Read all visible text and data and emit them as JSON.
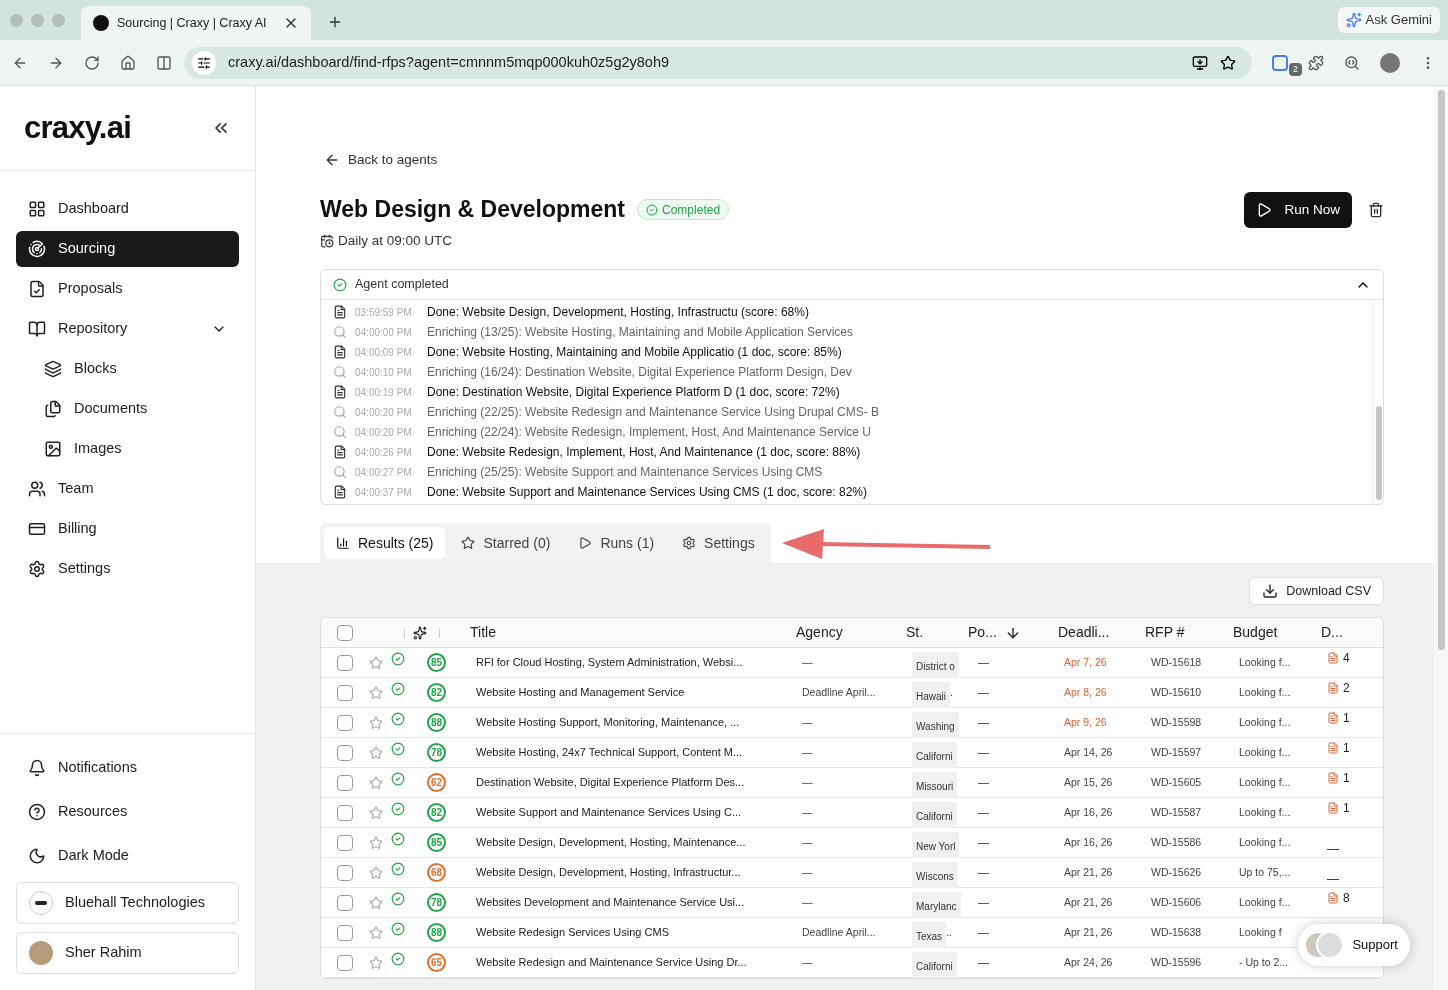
{
  "browser": {
    "tab_title": "Sourcing | Craxy | Craxy AI",
    "url": "craxy.ai/dashboard/find-rfps?agent=cmnnm5mqp000kuh0z5g2y8oh9",
    "gemini": "Ask Gemini",
    "tab_badge": "2"
  },
  "sidebar": {
    "logo": "craxy.ai",
    "items": [
      {
        "label": "Dashboard",
        "selected": false
      },
      {
        "label": "Sourcing",
        "selected": true
      },
      {
        "label": "Proposals",
        "selected": false
      },
      {
        "label": "Repository",
        "selected": false,
        "expanded": true,
        "children": [
          {
            "label": "Blocks",
            "selected": false
          },
          {
            "label": "Documents",
            "selected": false
          },
          {
            "label": "Images",
            "selected": false
          }
        ]
      },
      {
        "label": "Team",
        "selected": false
      },
      {
        "label": "Billing",
        "selected": false
      },
      {
        "label": "Settings",
        "selected": false
      }
    ],
    "bottom_items": [
      "Notifications",
      "Resources",
      "Dark Mode"
    ],
    "organization": "Bluehall Technologies",
    "user": "Sher Rahim"
  },
  "back_link": "Back to agents",
  "agent": {
    "title": "Web Design & Development",
    "status": "Completed",
    "schedule": "Daily at 09:00 UTC",
    "run_button": "Run Now"
  },
  "log": {
    "title": "Agent completed",
    "expanded": true,
    "entries": [
      {
        "kind": "done",
        "time": "03:59:59 PM",
        "text": "Done: Website Design, Development, Hosting, Infrastructu (score: 68%)"
      },
      {
        "kind": "enriching",
        "time": "04:00:00 PM",
        "text": "Enriching (13/25): Website Hosting, Maintaining and Mobile Application Services"
      },
      {
        "kind": "done",
        "time": "04:00:09 PM",
        "text": "Done: Website Hosting, Maintaining and Mobile Applicatio (1 doc, score: 85%)"
      },
      {
        "kind": "enriching",
        "time": "04:00:10 PM",
        "text": "Enriching (16/24): Destination Website, Digital Experience Platform Design, Dev"
      },
      {
        "kind": "done",
        "time": "04:00:19 PM",
        "text": "Done: Destination Website, Digital Experience Platform D (1 doc, score: 72%)"
      },
      {
        "kind": "enriching",
        "time": "04:00:20 PM",
        "text": "Enriching (22/25): Website Redesign and Maintenance Service Using Drupal CMS- B"
      },
      {
        "kind": "enriching",
        "time": "04:00:20 PM",
        "text": "Enriching (22/24): Website Redesign, Implement, Host, And Maintenance Service U"
      },
      {
        "kind": "done",
        "time": "04:00:26 PM",
        "text": "Done: Website Redesign, Implement, Host, And Maintenance (1 doc, score: 88%)"
      },
      {
        "kind": "enriching",
        "time": "04:00:27 PM",
        "text": "Enriching (25/25): Website Support and Maintenance Services Using CMS"
      },
      {
        "kind": "done",
        "time": "04:00:37 PM",
        "text": "Done: Website Support and Maintenance Services Using CMS (1 doc, score: 82%)"
      }
    ]
  },
  "tabs": [
    {
      "label": "Results (25)",
      "selected": true
    },
    {
      "label": "Starred (0)",
      "selected": false
    },
    {
      "label": "Runs (1)",
      "selected": false
    },
    {
      "label": "Settings",
      "selected": false
    }
  ],
  "download_button": "Download CSV",
  "table": {
    "all_checked": false,
    "columns": [
      "Title",
      "Agency",
      "St.",
      "Po...",
      "Deadli...",
      "RFP #",
      "Budget",
      "D..."
    ],
    "rows": [
      {
        "checked": false,
        "starred": false,
        "score": "85",
        "color": "#22a34a",
        "title": "RFI for Cloud Hosting, System Administration, Websi...",
        "agency": "—",
        "state": "District o",
        "po": "—",
        "deadline": "Apr 7, 26",
        "urgent": true,
        "rfp": "WD-15618",
        "budget": "Looking f...",
        "docs": "4"
      },
      {
        "checked": false,
        "starred": false,
        "score": "82",
        "color": "#22a34a",
        "title": "Website Hosting and Management Service",
        "agency": "Deadline April...",
        "state": "Hawaii",
        "state_more": ".",
        "po": "—",
        "deadline": "Apr 8, 26",
        "urgent": true,
        "rfp": "WD-15610",
        "budget": "Looking f...",
        "docs": "2"
      },
      {
        "checked": false,
        "starred": false,
        "score": "88",
        "color": "#22a34a",
        "title": "Website Hosting Support, Monitoring, Maintenance, ...",
        "agency": "—",
        "state": "Washing",
        "po": "—",
        "deadline": "Apr 9, 26",
        "urgent": true,
        "rfp": "WD-15598",
        "budget": "Looking f...",
        "docs": "1"
      },
      {
        "checked": false,
        "starred": false,
        "score": "78",
        "color": "#22a34a",
        "title": "Website Hosting, 24x7 Technical Support, Content M...",
        "agency": "—",
        "state": "Californi",
        "po": "—",
        "deadline": "Apr 14, 26",
        "urgent": false,
        "rfp": "WD-15597",
        "budget": "Looking f...",
        "docs": "1"
      },
      {
        "checked": false,
        "starred": false,
        "score": "62",
        "color": "#e0702f",
        "title": "Destination Website, Digital Experience Platform Des...",
        "agency": "—",
        "state": "Missouri",
        "po": "—",
        "deadline": "Apr 15, 26",
        "urgent": false,
        "rfp": "WD-15605",
        "budget": "Looking f...",
        "docs": "1"
      },
      {
        "checked": false,
        "starred": false,
        "score": "82",
        "color": "#22a34a",
        "title": "Website Support and Maintenance Services Using C...",
        "agency": "—",
        "state": "Californi",
        "po": "—",
        "deadline": "Apr 16, 26",
        "urgent": false,
        "rfp": "WD-15587",
        "budget": "Looking f...",
        "docs": "1"
      },
      {
        "checked": false,
        "starred": false,
        "score": "85",
        "color": "#22a34a",
        "title": "Website Design, Development, Hosting, Maintenance...",
        "agency": "—",
        "state": "New Yorl",
        "po": "—",
        "deadline": "Apr 16, 26",
        "urgent": false,
        "rfp": "WD-15586",
        "budget": "Looking f...",
        "docs_none": "—"
      },
      {
        "checked": false,
        "starred": false,
        "score": "68",
        "color": "#e0702f",
        "title": "Website Design, Development, Hosting, Infrastructur...",
        "agency": "—",
        "state": "Wiscons",
        "po": "—",
        "deadline": "Apr 21, 26",
        "urgent": false,
        "rfp": "WD-15626",
        "budget": "Up to 75,...",
        "docs_none": "—"
      },
      {
        "checked": false,
        "starred": false,
        "score": "78",
        "color": "#22a34a",
        "title": "Websites Development and Maintenance Service Usi...",
        "agency": "—",
        "state": "Marylanc",
        "po": "—",
        "deadline": "Apr 21, 26",
        "urgent": false,
        "rfp": "WD-15606",
        "budget": "Looking f...",
        "docs": "8"
      },
      {
        "checked": false,
        "starred": false,
        "score": "88",
        "color": "#22a34a",
        "title": "Website Redesign Services Using CMS",
        "agency": "Deadline April...",
        "state": "Texas",
        "state_more": "..",
        "po": "—",
        "deadline": "Apr 21, 26",
        "urgent": false,
        "rfp": "WD-15638",
        "budget": "Looking f"
      },
      {
        "checked": false,
        "starred": false,
        "score": "65",
        "color": "#e0702f",
        "title": "Website Redesign and Maintenance Service Using Dr...",
        "agency": "—",
        "state": "Californi",
        "po": "—",
        "deadline": "Apr 24, 26",
        "urgent": false,
        "rfp": "WD-15596",
        "budget": "- Up to 2..."
      }
    ]
  },
  "support_button": "Support"
}
